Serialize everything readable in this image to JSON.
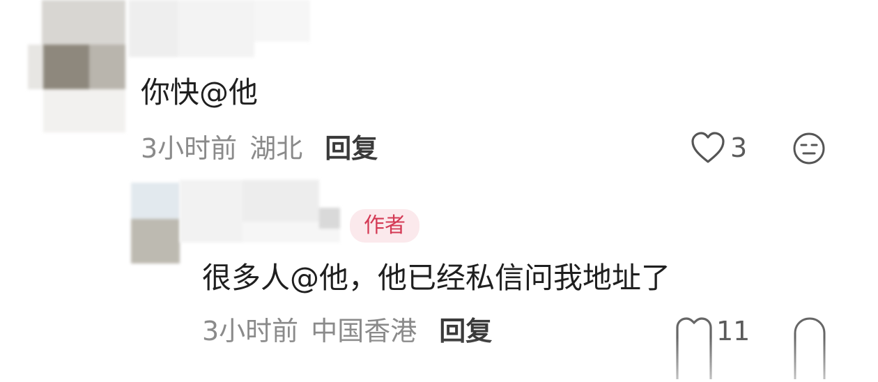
{
  "comments": [
    {
      "text": "你快@他",
      "time": "3小时前",
      "location": "湖北",
      "reply_label": "回复",
      "like_count": "3",
      "icons": {
        "like": "heart-outline-icon",
        "dislike": "meh-face-icon"
      }
    },
    {
      "badge": "作者",
      "text": "很多人@他，他已经私信问我地址了",
      "time": "3小时前",
      "location": "中国香港",
      "reply_label": "回复",
      "like_count": "11",
      "icons": {
        "like": "heart-outline-icon",
        "dislike": "meh-face-icon"
      }
    }
  ],
  "colors": {
    "text": "#1f1f1f",
    "meta": "#8a8a8a",
    "badge_bg": "#fbe9ec",
    "badge_text": "#d43a55"
  }
}
